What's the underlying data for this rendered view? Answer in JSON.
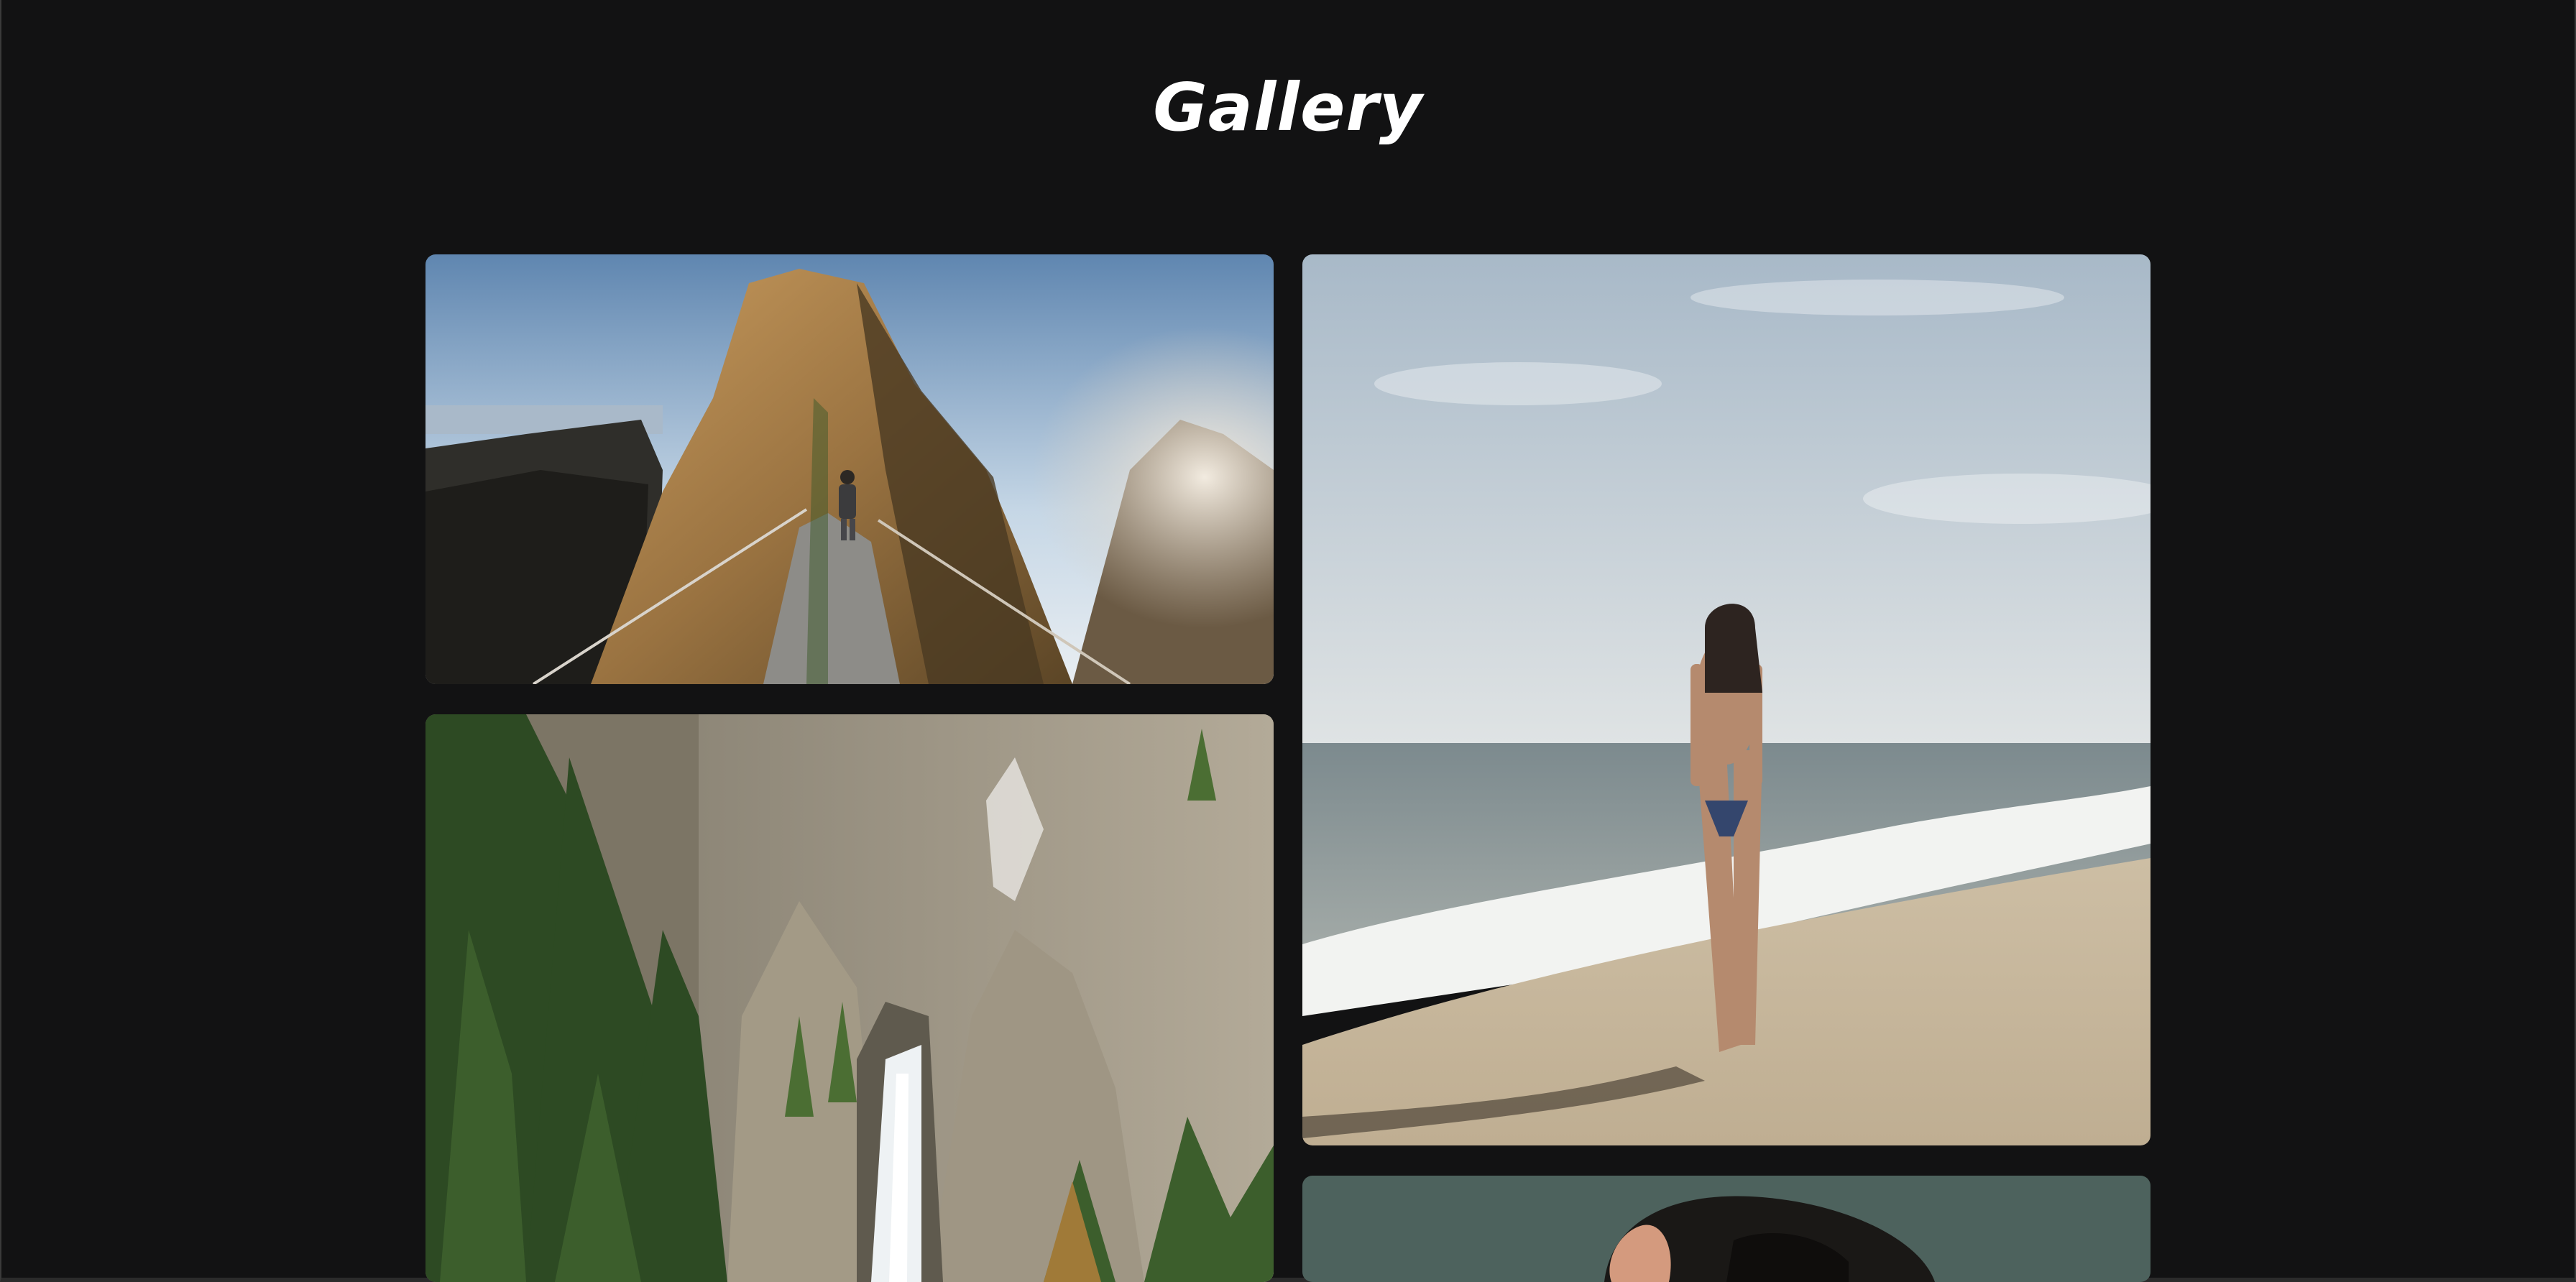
{
  "page": {
    "title": "Gallery"
  },
  "gallery": {
    "images": [
      {
        "subject": "hiker-on-mountain-ridge"
      },
      {
        "subject": "canyon-waterfall"
      },
      {
        "subject": "woman-on-beach"
      },
      {
        "subject": "portrait-partial"
      }
    ]
  },
  "colors": {
    "background": "#121213",
    "title": "#ffffff"
  }
}
